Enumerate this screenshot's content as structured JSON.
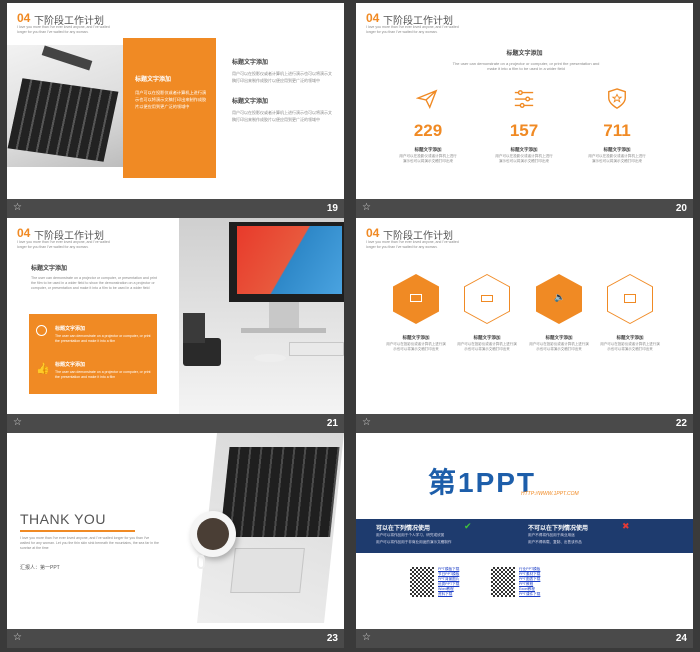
{
  "common": {
    "header_num": "04",
    "header_title": "下阶段工作计划",
    "header_sub": "I love you more than I've ever loved anyone, and I've waited longer for you than I've waited for any woman."
  },
  "s19": {
    "num": "19",
    "box_title": "标题文字添加",
    "box_text": "用户可以在投影仪或者计算机上进行演示也可以将演示文稿打印出来制作成胶片以便应用到更广泛的领域中",
    "h1": "标题文字添加",
    "t1": "用户可以在投影仪或者计算机上进行演示也可以将演示文稿打印出来制作成胶片以便应用到更广泛的领域中",
    "h2": "标题文字添加",
    "t2": "用户可以在投影仪或者计算机上进行演示也可以将演示文稿打印出来制作成胶片以便应用到更广泛的领域中"
  },
  "s20": {
    "num": "20",
    "title": "标题文字添加",
    "desc": "The user can demonstrate on a projector or computer, or print the presentation and make it into a film to be used in a wider field",
    "stats": [
      {
        "value": "229",
        "label": "标题文字添加",
        "text": "用户可以在投影仪或者计算机上进行演示也可以将演示文稿打印出来"
      },
      {
        "value": "157",
        "label": "标题文字添加",
        "text": "用户可以在投影仪或者计算机上进行演示也可以将演示文稿打印出来"
      },
      {
        "value": "711",
        "label": "标题文字添加",
        "text": "用户可以在投影仪或者计算机上进行演示也可以将演示文稿打印出来"
      }
    ]
  },
  "s21": {
    "num": "21",
    "title": "标题文字添加",
    "desc": "The user can demonstrate on a projector or computer, or presentation and print the film to be used in a wider field to show the demonstration on a projector or computer, or presentation and make it into a film to be used in a wider field",
    "item1_title": "标题文字添加",
    "item1_text": "The user can demonstrate on a projector or computer, or print the presentation and make it into a film",
    "item2_title": "标题文字添加",
    "item2_text": "The user can demonstrate on a projector or computer, or print the presentation and make it into a film"
  },
  "s22": {
    "num": "22",
    "items": [
      {
        "label": "标题文字添加",
        "text": "用户可以在投影仪或者计算机上进行演示也可以将演示文稿打印出来"
      },
      {
        "label": "标题文字添加",
        "text": "用户可以在投影仪或者计算机上进行演示也可以将演示文稿打印出来"
      },
      {
        "label": "标题文字添加",
        "text": "用户可以在投影仪或者计算机上进行演示也可以将演示文稿打印出来"
      },
      {
        "label": "标题文字添加",
        "text": "用户可以在投影仪或者计算机上进行演示也可以将演示文稿打印出来"
      }
    ]
  },
  "s23": {
    "num": "23",
    "title": "THANK YOU",
    "sub": "I love you more than I've ever loved anyone, and I've waited longer for you than I've waited for any woman. Let you the thin skin sink beneath the mountains, the sea far in the sunrise at the time",
    "reporter": "汇报人：第一PPT"
  },
  "s24": {
    "num": "24",
    "logo_main": "第1PPT",
    "logo_url": "HTTP://WWW.1PPT.COM",
    "can_title": "可以在下列情况使用",
    "can_items": [
      "用户可以将作品用于个人学习、研究或欣赏",
      "用户可以将作品用于非商业用途的演示文稿制作"
    ],
    "cannot_title": "不可以在下列情况使用",
    "cannot_items": [
      "用户不得将作品用于商业用途",
      "用户不得转载、复制、出售该作品"
    ],
    "links_left": [
      "PPT模板下载",
      "节日PPT模板",
      "PPT背景图片",
      "优秀PPT下载",
      "Word教程",
      "资料下载"
    ],
    "links_right": [
      "行业PPT模板",
      "PPT素材下载",
      "PPT图表下载",
      "PPT教程",
      "Excel教程",
      "PPT课件下载"
    ]
  }
}
